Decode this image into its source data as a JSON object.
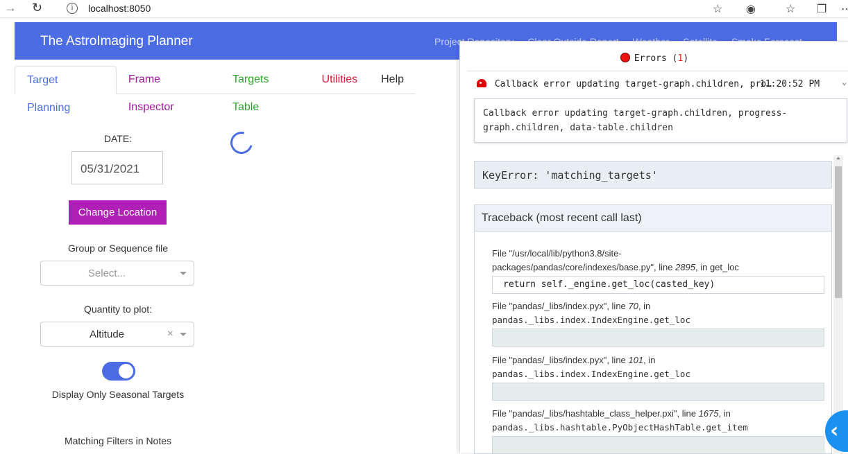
{
  "browser": {
    "url": "localhost:8050"
  },
  "header": {
    "title": "The AstroImaging Planner",
    "links": [
      "Project Repository",
      "Clear Outside Report",
      "Weather",
      "Satellite",
      "Smoke Forecast"
    ]
  },
  "tabs": [
    {
      "label": "Target Planning",
      "color": "#4c6ce4"
    },
    {
      "label": "Frame Inspector",
      "color": "#a0179c"
    },
    {
      "label": "Targets Table",
      "color": "#2ea52e"
    },
    {
      "label": "Utilities",
      "color": "#d31a3a"
    },
    {
      "label": "Help",
      "color": "#333333"
    }
  ],
  "left": {
    "date_label": "DATE:",
    "date_value": "05/31/2021",
    "change_location": "Change Location",
    "group_label": "Group or Sequence file",
    "group_placeholder": "Select...",
    "quantity_label": "Quantity to plot:",
    "quantity_value": "Altitude",
    "seasonal_label": "Display Only Seasonal Targets",
    "seasonal_on": true,
    "filters_label": "Matching Filters in Notes"
  },
  "errors": {
    "title": "Errors",
    "count": "1",
    "row_text": "Callback error updating target-graph.children, pro…",
    "row_time": "11:20:52 PM",
    "message_line1": "Callback error updating target-graph.children, progress-",
    "message_line2": "graph.children, data-table.children",
    "key_error": "KeyError: 'matching_targets'",
    "traceback_title": "Traceback (most recent call last)",
    "frames": [
      {
        "file_prefix": "File \"/usr/local/lib/python3.8/site-",
        "file_line2": "packages/pandas/core/indexes/base.py\", line ",
        "line_no": "2895",
        "fn": ", in get_loc",
        "code": "return self._engine.get_loc(casted_key)"
      },
      {
        "file_prefix": "File \"pandas/_libs/index.pyx\", line ",
        "line_no": "70",
        "fn": ", in",
        "fn_line2": "pandas._libs.index.IndexEngine.get_loc",
        "code": ""
      },
      {
        "file_prefix": "File \"pandas/_libs/index.pyx\", line ",
        "line_no": "101",
        "fn": ", in",
        "fn_line2": "pandas._libs.index.IndexEngine.get_loc",
        "code": ""
      },
      {
        "file_prefix": "File \"pandas/_libs/hashtable_class_helper.pxi\", line ",
        "line_no": "1675",
        "fn": ", in",
        "fn_line2": "pandas._libs.hashtable.PyObjectHashTable.get_item",
        "code": ""
      }
    ]
  }
}
